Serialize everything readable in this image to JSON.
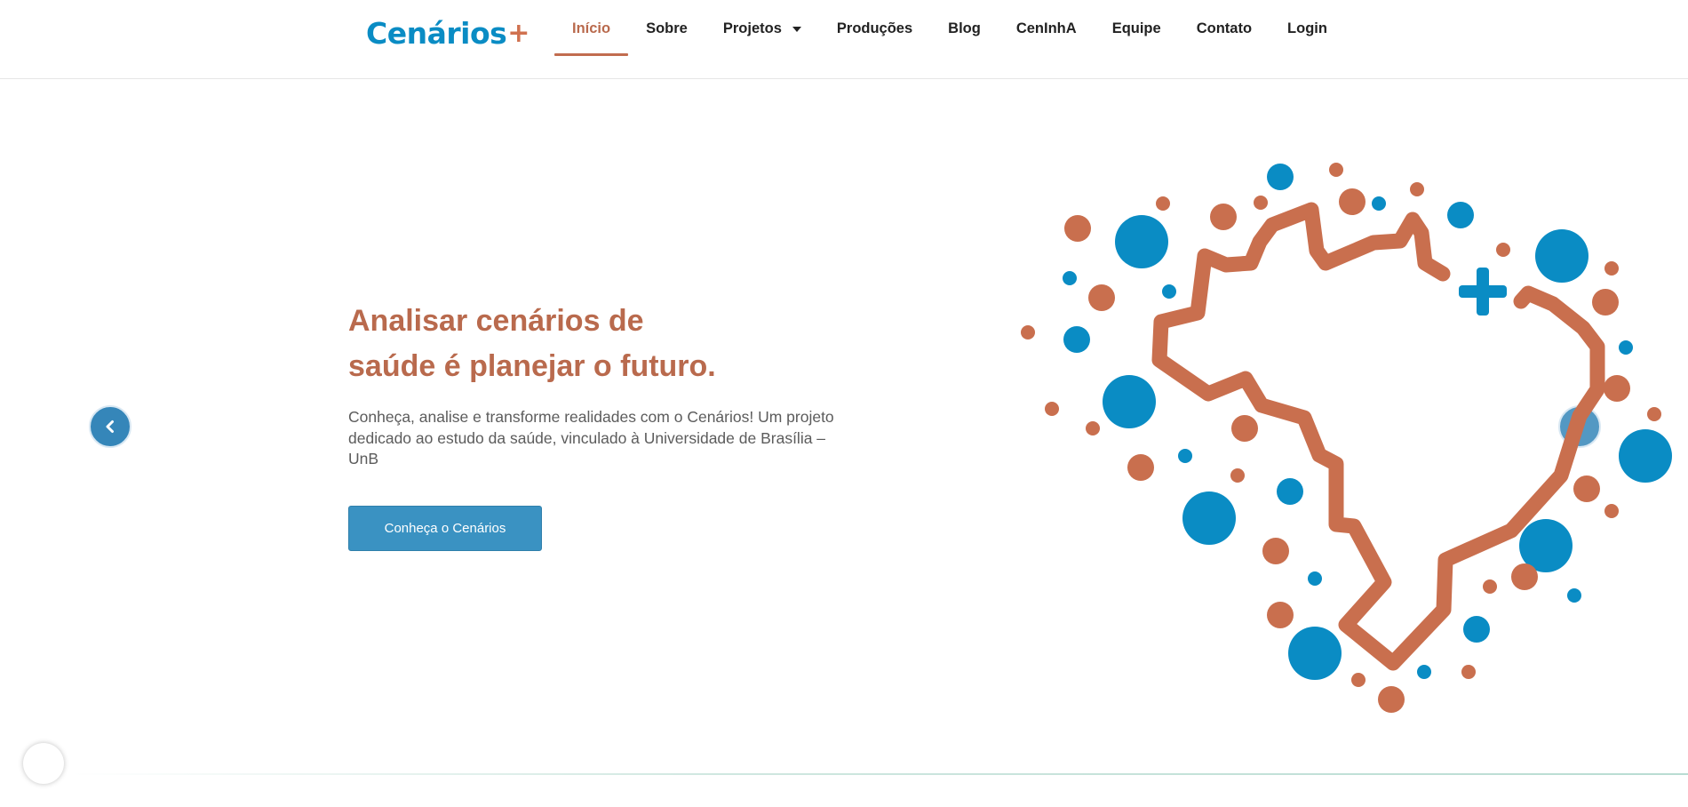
{
  "brand": {
    "logo_text": "Cenários",
    "logo_plus": "+",
    "primary_color": "#0a8cc4",
    "accent_color": "#c26c4f"
  },
  "nav": {
    "items": [
      {
        "label": "Início",
        "active": true
      },
      {
        "label": "Sobre"
      },
      {
        "label": "Projetos",
        "has_dropdown": true
      },
      {
        "label": "Produções"
      },
      {
        "label": "Blog"
      },
      {
        "label": "CenInhA"
      },
      {
        "label": "Equipe"
      },
      {
        "label": "Contato"
      },
      {
        "label": "Login"
      }
    ]
  },
  "hero": {
    "title_line1": "Analisar cenários de",
    "title_line2": "saúde é planejar o futuro.",
    "description": "Conheça, analise e transforme realidades com o Cenários! Um projeto dedicado ao estudo da saúde, vinculado à Universidade de Brasília – UnB",
    "cta_label": "Conheça o Cenários"
  },
  "carousel": {
    "prev_icon": "chevron-left-icon",
    "next_icon": "chevron-right-icon"
  },
  "illustration": {
    "icon": "brazil-map-health-icon",
    "colors": [
      "#0a8cc4",
      "#c96f4e"
    ]
  }
}
